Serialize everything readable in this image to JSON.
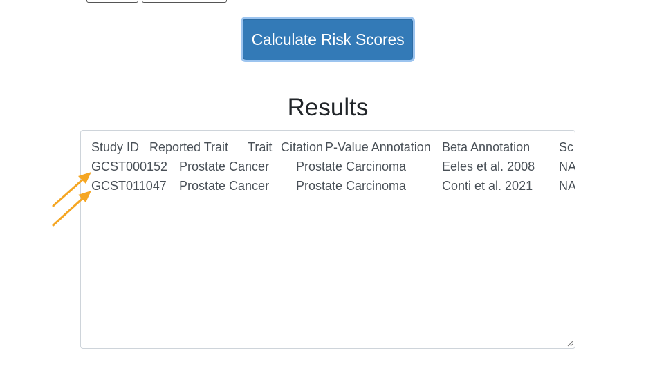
{
  "actions": {
    "calculate_label": "Calculate Risk Scores"
  },
  "results": {
    "heading": "Results",
    "columns": [
      "Study ID",
      "Reported Trait",
      "Trait",
      "Citation",
      "P-Value Annotation",
      "Beta Annotation",
      "Sc"
    ],
    "rows": [
      {
        "study_id": "GCST000152",
        "reported_trait": "Prostate Cancer",
        "trait": "Prostate Carcinoma",
        "citation": "Eeles et al. 2008",
        "pvalue_annotation": "NA"
      },
      {
        "study_id": "GCST011047",
        "reported_trait": "Prostate Cancer",
        "trait": "Prostate Carcinoma",
        "citation": "Conti et al. 2021",
        "pvalue_annotation": "NA"
      }
    ]
  },
  "colors": {
    "button_bg": "#337ab7",
    "button_focus_ring": "#9cc4ef",
    "arrow": "#f5a623",
    "text": "#495057"
  }
}
